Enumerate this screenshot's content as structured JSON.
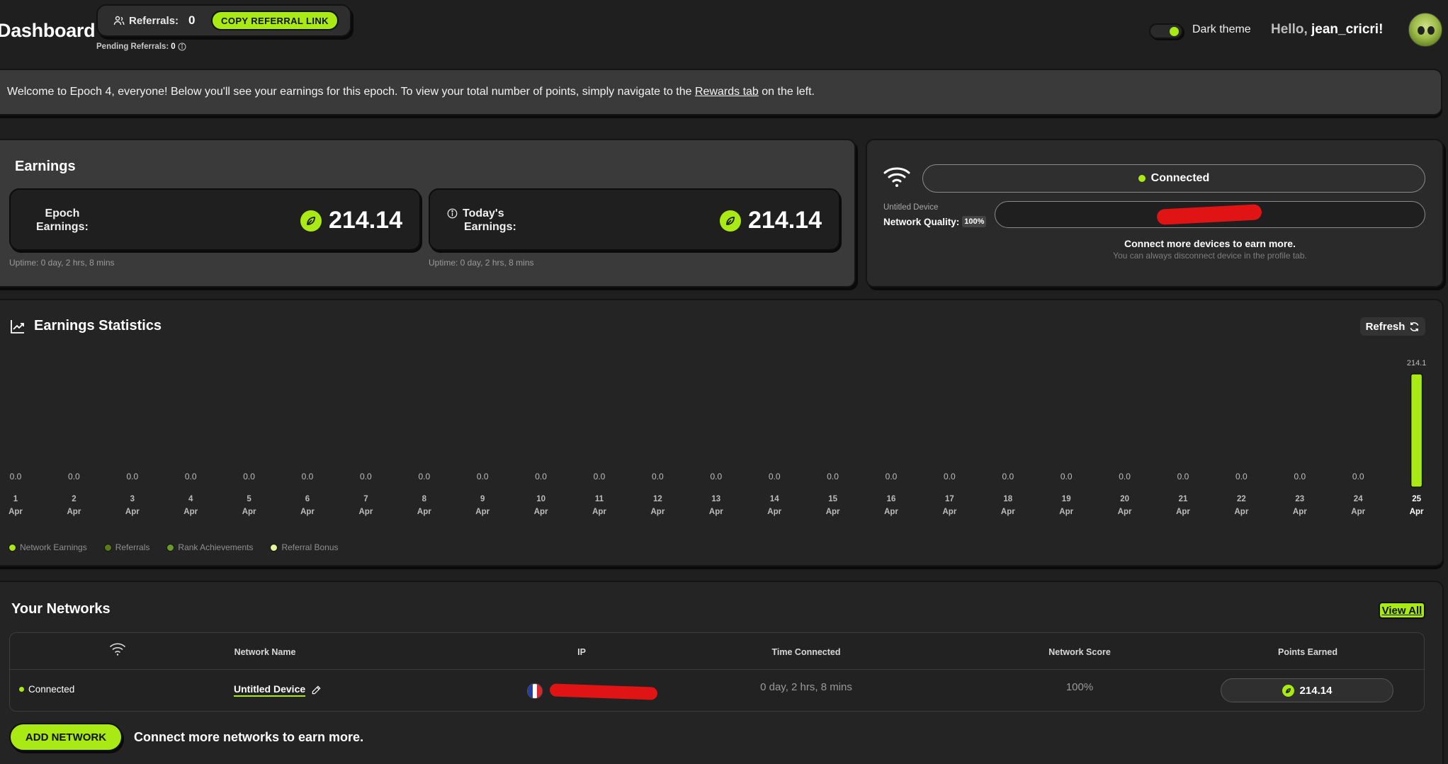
{
  "header": {
    "title": "Dashboard",
    "referrals_label": "Referrals:",
    "referrals_count": "0",
    "copy_referral_label": "COPY REFERRAL LINK",
    "pending_label": "Pending Referrals:",
    "pending_count": "0",
    "theme_label": "Dark theme",
    "hello": "Hello,",
    "username": "jean_cricri!"
  },
  "announcement": {
    "text_before": "Welcome to Epoch 4, everyone! Below you'll see your earnings for this epoch. To view your total number of points, simply navigate to the",
    "link_text": "Rewards tab",
    "text_after": "on the left."
  },
  "earnings": {
    "title": "Earnings",
    "epoch_label_line1": "Epoch",
    "epoch_label_line2": "Earnings:",
    "epoch_value": "214.14",
    "today_label_line1": "Today's",
    "today_label_line2": "Earnings:",
    "today_value": "214.14",
    "epoch_uptime": "Uptime: 0 day, 2 hrs, 8 mins",
    "today_uptime": "Uptime: 0 day, 2 hrs, 8 mins"
  },
  "device": {
    "status": "Connected",
    "device_name": "Untitled Device",
    "quality_label": "Network Quality:",
    "quality_value": "100%",
    "more_devices": "Connect more devices to earn more.",
    "more_devices_sub": "You can always disconnect device in the profile tab."
  },
  "stats": {
    "title": "Earnings Statistics",
    "refresh_label": "Refresh"
  },
  "chart_data": {
    "type": "bar",
    "categories": [
      "1 Apr",
      "2 Apr",
      "3 Apr",
      "4 Apr",
      "5 Apr",
      "6 Apr",
      "7 Apr",
      "8 Apr",
      "9 Apr",
      "10 Apr",
      "11 Apr",
      "12 Apr",
      "13 Apr",
      "14 Apr",
      "15 Apr",
      "16 Apr",
      "17 Apr",
      "18 Apr",
      "19 Apr",
      "20 Apr",
      "21 Apr",
      "22 Apr",
      "23 Apr",
      "24 Apr",
      "25 Apr"
    ],
    "day_labels": [
      "1",
      "2",
      "3",
      "4",
      "5",
      "6",
      "7",
      "8",
      "9",
      "10",
      "11",
      "12",
      "13",
      "14",
      "15",
      "16",
      "17",
      "18",
      "19",
      "20",
      "21",
      "22",
      "23",
      "24",
      "25"
    ],
    "month_label": "Apr",
    "values": [
      0,
      0,
      0,
      0,
      0,
      0,
      0,
      0,
      0,
      0,
      0,
      0,
      0,
      0,
      0,
      0,
      0,
      0,
      0,
      0,
      0,
      0,
      0,
      0,
      214.1
    ],
    "value_labels": [
      "0.0",
      "0.0",
      "0.0",
      "0.0",
      "0.0",
      "0.0",
      "0.0",
      "0.0",
      "0.0",
      "0.0",
      "0.0",
      "0.0",
      "0.0",
      "0.0",
      "0.0",
      "0.0",
      "0.0",
      "0.0",
      "0.0",
      "0.0",
      "0.0",
      "0.0",
      "0.0",
      "0.0",
      "214.1"
    ],
    "ylim": [
      0,
      214.1
    ],
    "grid": false,
    "legend_position": "bottom-left",
    "legend": [
      {
        "name": "Network Earnings",
        "color": "#a9ea15"
      },
      {
        "name": "Referrals",
        "color": "#5a7a1c"
      },
      {
        "name": "Rank Achievements",
        "color": "#6a9a2a"
      },
      {
        "name": "Referral Bonus",
        "color": "#e8f49a"
      }
    ],
    "bar_color": "#a9ea15"
  },
  "networks": {
    "title": "Your Networks",
    "view_all_label": "View All",
    "columns": [
      "Network Name",
      "IP",
      "Time Connected",
      "Network Score",
      "Points Earned"
    ],
    "rows": [
      {
        "status": "Connected",
        "name": "Untitled Device",
        "time_connected": "0 day, 2 hrs, 8 mins",
        "score": "100%",
        "points": "214.14"
      }
    ],
    "add_label": "ADD NETWORK",
    "add_text": "Connect more networks to earn more."
  },
  "colors": {
    "accent": "#a9ea15",
    "background": "#1f1f1f",
    "panel": "#3a3a3a",
    "redaction": "#e01414"
  }
}
